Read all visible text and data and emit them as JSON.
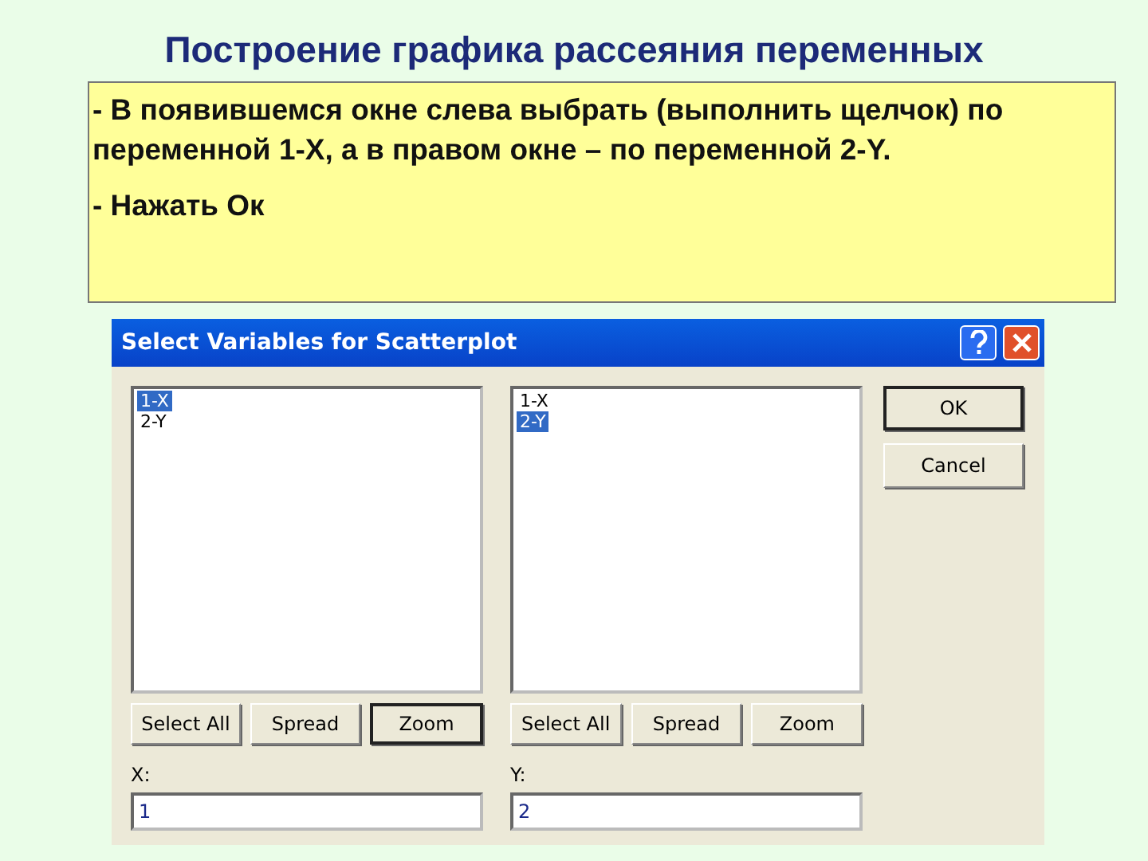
{
  "slide": {
    "title": "Построение графика рассеяния переменных",
    "notes": [
      "- В появившемся окне слева выбрать (выполнить щелчок) по переменной 1-X, а в правом окне – по переменной 2-Y.",
      "- Нажать Ок"
    ]
  },
  "dialog": {
    "title": "Select Variables for Scatterplot",
    "panes": [
      {
        "items": [
          {
            "label": "1-X",
            "selected": true
          },
          {
            "label": "2-Y",
            "selected": false
          }
        ],
        "buttons": [
          {
            "label": "Select All",
            "focused": false
          },
          {
            "label": "Spread",
            "focused": false
          },
          {
            "label": "Zoom",
            "focused": true
          }
        ],
        "field_label": "X:",
        "field_value": "1"
      },
      {
        "items": [
          {
            "label": "1-X",
            "selected": false
          },
          {
            "label": "2-Y",
            "selected": true
          }
        ],
        "buttons": [
          {
            "label": "Select All",
            "focused": false
          },
          {
            "label": "Spread",
            "focused": false
          },
          {
            "label": "Zoom",
            "focused": false
          }
        ],
        "field_label": "Y:",
        "field_value": "2"
      }
    ],
    "side_buttons": [
      {
        "label": "OK",
        "focused": true
      },
      {
        "label": "Cancel",
        "focused": false
      }
    ]
  }
}
